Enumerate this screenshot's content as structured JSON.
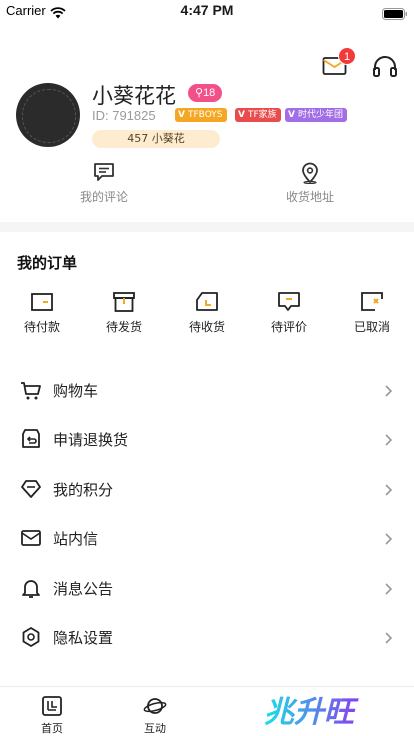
{
  "status_bar": {
    "carrier": "Carrier",
    "time": "4:47 PM"
  },
  "header": {
    "message_badge": "1"
  },
  "profile": {
    "username": "小葵花花",
    "level": "18",
    "id_text": "ID: 791825",
    "tags": [
      "TFBOYS",
      "TF家族",
      "时代少年团"
    ],
    "points": "457 小葵花"
  },
  "quick_links": [
    {
      "label": "我的评论",
      "icon": "comment-icon"
    },
    {
      "label": "收货地址",
      "icon": "location-pin-icon"
    }
  ],
  "orders": {
    "title": "我的订单",
    "items": [
      {
        "label": "待付款",
        "icon": "wallet-icon"
      },
      {
        "label": "待发货",
        "icon": "package-icon"
      },
      {
        "label": "待收货",
        "icon": "truck-icon"
      },
      {
        "label": "待评价",
        "icon": "review-icon"
      },
      {
        "label": "已取消",
        "icon": "cancelled-icon"
      }
    ]
  },
  "menu": [
    {
      "label": "购物车",
      "icon": "cart-icon"
    },
    {
      "label": "申请退换货",
      "icon": "return-icon"
    },
    {
      "label": "我的积分",
      "icon": "diamond-icon"
    },
    {
      "label": "站内信",
      "icon": "mail-icon"
    },
    {
      "label": "消息公告",
      "icon": "bell-icon"
    },
    {
      "label": "隐私设置",
      "icon": "gear-icon"
    }
  ],
  "tabbar": {
    "home": "首页",
    "interact": "互动",
    "brand": "兆升旺"
  },
  "colors": {
    "badge": "#f33a3a",
    "level": "#f2508a",
    "tag_tfboys": "#f5a623",
    "tag_family": "#e84c4c",
    "tag_team": "#a26ee6",
    "points_bg": "#fdeccf",
    "brand_cyan": "#19e0e6",
    "brand_purple": "#8a3df0"
  }
}
